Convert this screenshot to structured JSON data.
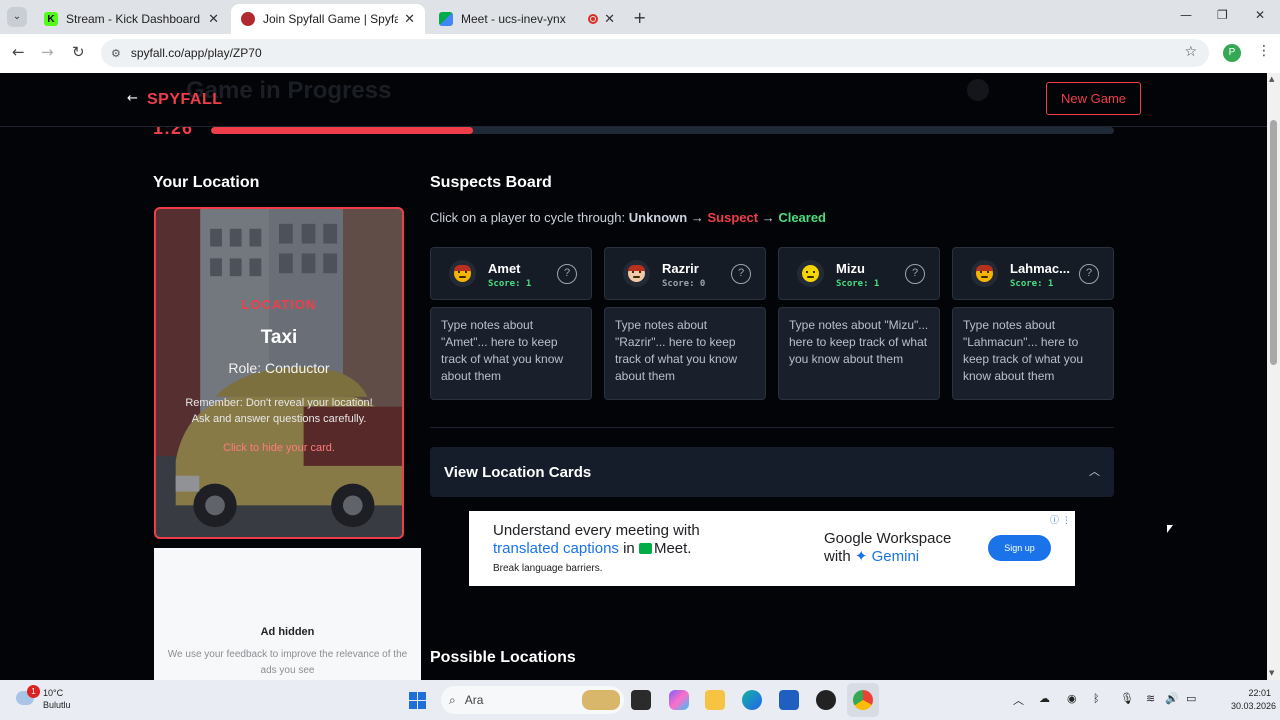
{
  "browser": {
    "tabs": [
      {
        "title": "Stream - Kick Dashboard",
        "favicon": "kick-icon",
        "active": false
      },
      {
        "title": "Join Spyfall Game | Spyfall Online",
        "favicon": "spyfall-icon",
        "active": true
      },
      {
        "title": "Meet - ucs-inev-ynx",
        "favicon": "meet-icon",
        "active": false,
        "recording": true
      }
    ],
    "url": "spyfall.co/app/play/ZP70",
    "profile_initial": "P"
  },
  "header": {
    "ghost_title": "Game in Progress",
    "logo": "SPYFALL",
    "new_game_label": "New Game"
  },
  "timer": {
    "display": "1:26",
    "progress_fraction": 0.29
  },
  "location_section": {
    "title": "Your Location",
    "tag": "Location",
    "name": "Taxi",
    "role": "Role: Conductor",
    "reminder": "Remember: Don't reveal your location! Ask and answer questions carefully.",
    "hide_hint": "Click to hide your card."
  },
  "ad_hidden": {
    "title": "Ad hidden",
    "text": "We use your feedback to improve the relevance of the ads you see"
  },
  "suspects": {
    "title": "Suspects Board",
    "instruction_prefix": "Click on a player to cycle through:",
    "state_unknown": "Unknown",
    "state_suspect": "Suspect",
    "state_cleared": "Cleared",
    "arrow": "→",
    "players": [
      {
        "name": "Amet",
        "score": "Score: 1",
        "score_color": "#4ade80",
        "face_color": "#f5b400",
        "hair": true,
        "notes": "Type notes about \"Amet\"... here to keep track of what you know about them"
      },
      {
        "name": "Razrir",
        "score": "Score: 0",
        "score_color": "#9aa3ae",
        "face_color": "#f2c9a8",
        "hair": true,
        "notes": "Type notes about \"Razrir\"... here to keep track of what you know about them"
      },
      {
        "name": "Mizu",
        "score": "Score: 1",
        "score_color": "#4ade80",
        "face_color": "#f5d400",
        "hair": false,
        "notes": "Type notes about \"Mizu\"... here to keep track of what you know about them"
      },
      {
        "name": "Lahmac...",
        "score": "Score: 1",
        "score_color": "#4ade80",
        "face_color": "#f5b400",
        "hair": true,
        "notes": "Type notes about \"Lahmacun\"... here to keep track of what you know about them"
      }
    ]
  },
  "accordion": {
    "label": "View Location Cards"
  },
  "ad_banner": {
    "headline_1": "Understand every meeting with",
    "headline_2_blue": "translated captions",
    "headline_2_rest": "in",
    "headline_2_meet": "Meet.",
    "subline": "Break language barriers.",
    "brand_1": "Google Workspace",
    "brand_2_with": "with",
    "brand_2_gemini": "Gemini",
    "cta": "Sign up"
  },
  "possible_locations": {
    "title": "Possible Locations"
  },
  "taskbar": {
    "weather_temp": "10°C",
    "weather_cond": "Bulutlu",
    "weather_badge": "1",
    "search_label": "Ara",
    "time": "22:01",
    "date": "30.03.2026"
  }
}
